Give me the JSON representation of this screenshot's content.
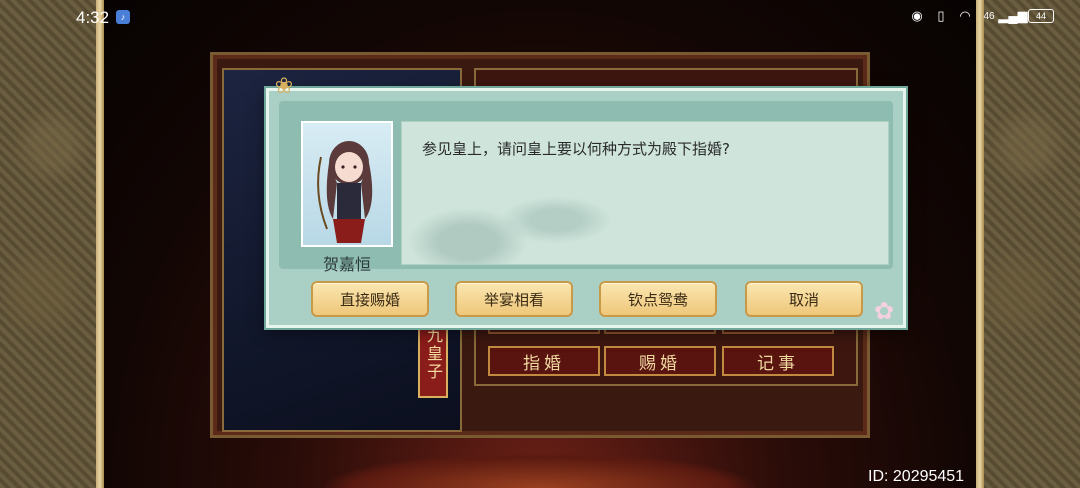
{
  "status_bar": {
    "time": "4:32",
    "network": "46",
    "battery": "44"
  },
  "dialog": {
    "speaker": "贺嘉恒",
    "message": "参见皇上，请问皇上要以何种方式为殿下指婚?",
    "choices": [
      "直接赐婚",
      "举宴相看",
      "钦点鸳鸯",
      "取消"
    ]
  },
  "background": {
    "rank_tag": "九皇子",
    "actions": [
      "指婚",
      "赐婚",
      "记事"
    ]
  },
  "player_id": "ID: 20295451",
  "colors": {
    "dialog_bg": "#aacfc4",
    "button_gold": "#eec77a",
    "frame_red": "#5a1410"
  }
}
